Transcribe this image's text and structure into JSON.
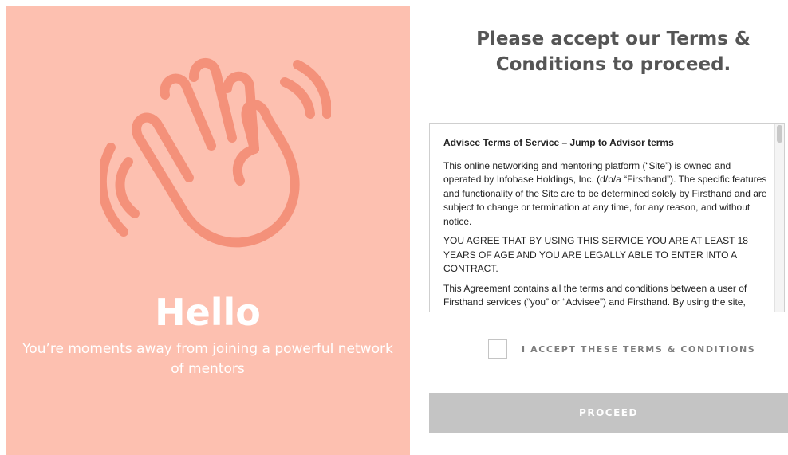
{
  "colors": {
    "left_panel_bg": "#fdc0b0",
    "icon_stroke": "#f4917a",
    "heading": "#555555",
    "proceed_button_bg": "#c4c4c4"
  },
  "left_panel": {
    "icon": "waving-hand-icon",
    "title": "Hello",
    "subtitle": "You’re moments away from joining a powerful network of mentors"
  },
  "heading": "Please accept our Terms & Conditions to proceed.",
  "terms": {
    "title": "Advisee Terms of Service – Jump to Advisor terms",
    "paragraphs": [
      "This online networking and mentoring platform (“Site”) is owned and operated by Infobase Holdings, Inc. (d/b/a “Firsthand”). The specific features and functionality of the Site are to be determined solely by Firsthand and are subject to change or termination at any time, for any reason, and without notice.",
      "YOU AGREE THAT BY USING THIS SERVICE YOU ARE AT LEAST 18 YEARS OF AGE AND YOU ARE LEGALLY ABLE TO ENTER INTO A CONTRACT.",
      "This Agreement contains all the terms and conditions between a user of Firsthand services (“you” or “Advisee”) and Firsthand. By using the site,"
    ]
  },
  "accept_label": "I ACCEPT THESE TERMS & CONDITIONS",
  "proceed_label": "PROCEED"
}
